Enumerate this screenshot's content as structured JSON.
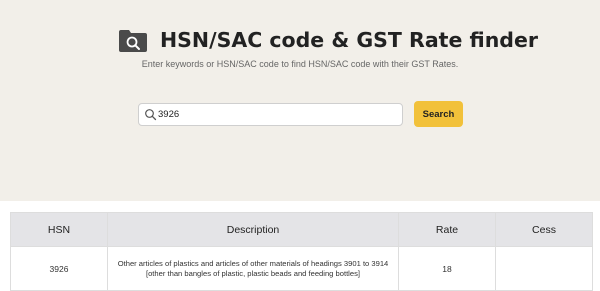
{
  "header": {
    "title": "HSN/SAC code & GST Rate finder",
    "subtitle": "Enter keywords or HSN/SAC code to find HSN/SAC code with their GST Rates."
  },
  "search": {
    "value": "3926",
    "button_label": "Search"
  },
  "table": {
    "columns": [
      "HSN",
      "Description",
      "Rate",
      "Cess"
    ],
    "rows": [
      {
        "hsn": "3926",
        "description_line1": "Other articles of plastics and articles of other materials of headings 3901 to 3914",
        "description_line2": "[other than bangles of plastic, plastic beads and feeding bottles]",
        "rate": "18",
        "cess": ""
      }
    ]
  },
  "colors": {
    "hero_background": "#f2efe9",
    "button": "#f2c13a",
    "table_header": "#e4e4e7",
    "logo": "#4a4a4a"
  },
  "icons": {
    "logo": "folder-search-icon",
    "search": "search-icon"
  }
}
